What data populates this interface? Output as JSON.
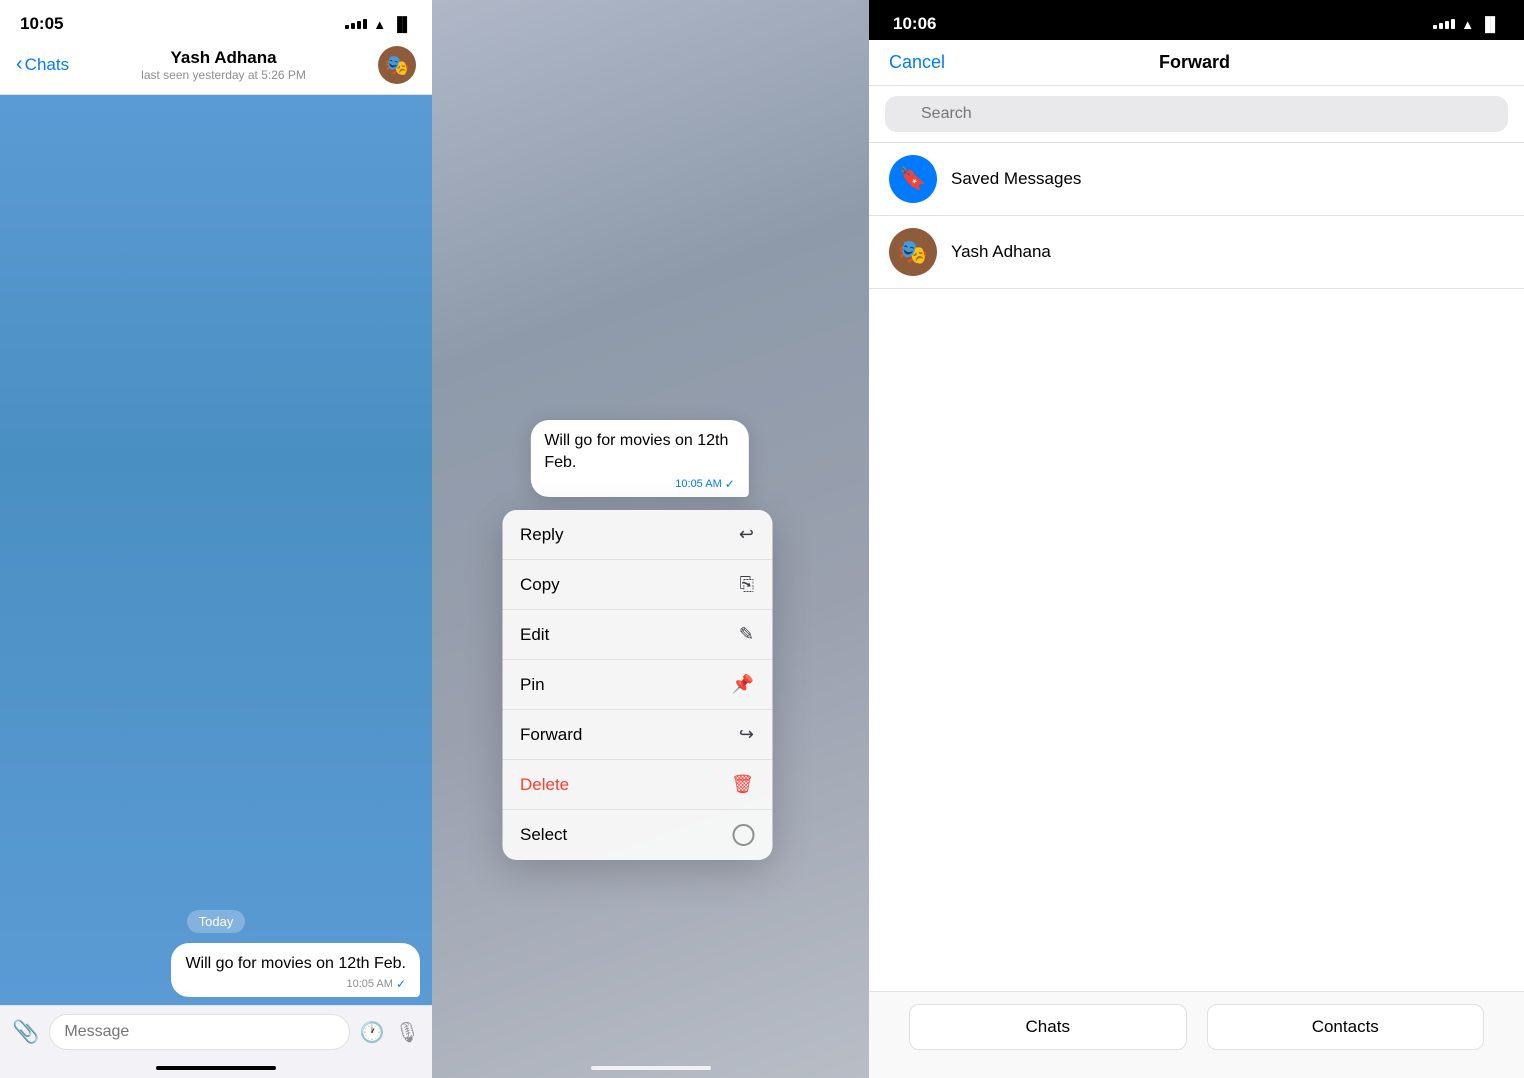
{
  "panel1": {
    "statusBar": {
      "time": "10:05"
    },
    "navBar": {
      "backLabel": "Chats",
      "contactName": "Yash Adhana",
      "contactStatus": "last seen yesterday at 5:26 PM"
    },
    "chat": {
      "dateBadge": "Today",
      "messageText": "Will go for movies on 12th Feb.",
      "messageTime": "10:05 AM",
      "checkMark": "✓"
    },
    "inputBar": {
      "placeholder": "Message"
    }
  },
  "panel2": {
    "messageText": "Will go for movies on 12th Feb.",
    "messageTime": "10:05 AM",
    "checkMark": "✓",
    "contextMenu": {
      "items": [
        {
          "label": "Reply",
          "icon": "↩",
          "isDelete": false
        },
        {
          "label": "Copy",
          "icon": "⎘",
          "isDelete": false
        },
        {
          "label": "Edit",
          "icon": "✎",
          "isDelete": false
        },
        {
          "label": "Pin",
          "icon": "📌",
          "isDelete": false
        },
        {
          "label": "Forward",
          "icon": "↪",
          "isDelete": false
        },
        {
          "label": "Delete",
          "icon": "🗑",
          "isDelete": true
        },
        {
          "label": "Select",
          "icon": "✓",
          "isDelete": false
        }
      ]
    }
  },
  "panel3": {
    "statusBar": {
      "time": "10:06"
    },
    "navBar": {
      "cancelLabel": "Cancel",
      "title": "Forward"
    },
    "searchBar": {
      "placeholder": "Search"
    },
    "contacts": [
      {
        "name": "Saved Messages",
        "type": "saved"
      },
      {
        "name": "Yash Adhana",
        "type": "yash"
      }
    ],
    "tabs": [
      {
        "label": "Chats"
      },
      {
        "label": "Contacts"
      }
    ]
  }
}
